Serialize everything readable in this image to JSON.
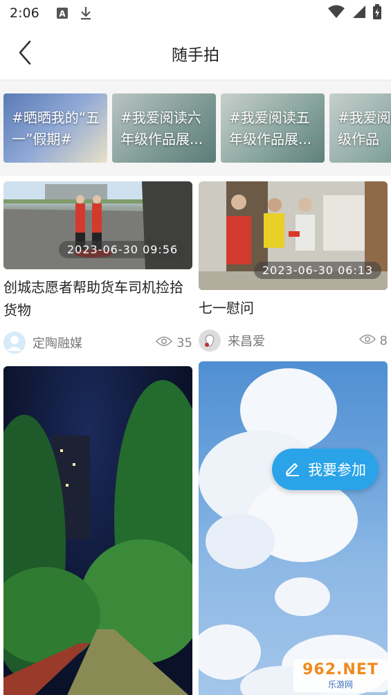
{
  "status_bar": {
    "time": "2:06"
  },
  "header": {
    "title": "随手拍"
  },
  "topics": [
    {
      "label": "#晒晒我的“五一”假期#"
    },
    {
      "label": "#我爱阅读六年级作品展..."
    },
    {
      "label": "#我爱阅读五年级作品展..."
    },
    {
      "label": "#我爱阅读年级作品"
    }
  ],
  "posts": [
    {
      "time": "2023-06-30  09:56",
      "title": "创城志愿者帮助货车司机捡拾货物",
      "author": "定陶融媒",
      "views": "35"
    },
    {
      "time": "2023-06-30  06:13",
      "title": "七一慰问",
      "author": "来昌爱",
      "views": "8"
    }
  ],
  "fab": {
    "label": "我要参加"
  },
  "watermark": {
    "top": "962.NET",
    "bottom": "乐游网"
  },
  "colors": {
    "accent": "#2aa3e8"
  }
}
